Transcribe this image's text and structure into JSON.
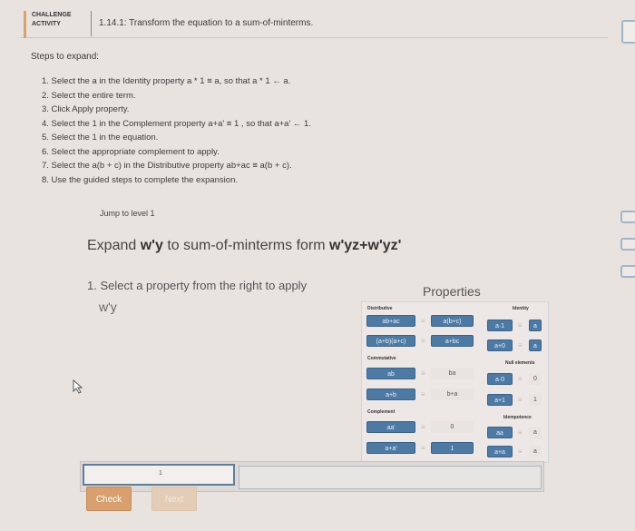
{
  "header": {
    "activity_line1": "CHALLENGE",
    "activity_line2": "ACTIVITY",
    "title": "1.14.1: Transform the equation to a sum-of-minterms."
  },
  "steps": {
    "title": "Steps to expand:",
    "items": [
      "1. Select the a in the Identity property a * 1 ≡ a, so that a * 1 ← a.",
      "2. Select the entire term.",
      "3. Click Apply property.",
      "4. Select the 1 in the Complement property a+a' ≡ 1 , so that a+a' ← 1.",
      "5. Select the 1 in the equation.",
      "6. Select the appropriate complement to apply.",
      "7. Select the a(b + c) in the Distributive property ab+ac ≡ a(b + c).",
      "8. Use the guided steps to complete the expansion."
    ]
  },
  "activity": {
    "jump_label": "Jump to level 1",
    "expand_prefix": "Expand ",
    "expand_expr": "w'y",
    "expand_middle": " to sum-of-minterms form ",
    "expand_target": "w'yz+w'yz'",
    "instruction": "1. Select a property from the right to apply",
    "current_expr": "w'y",
    "answer_value": "1",
    "check_label": "Check",
    "next_label": "Next"
  },
  "properties": {
    "title": "Properties",
    "left_column": {
      "distributive_label": "Distributive",
      "commutative_label": "Commutative",
      "complement_label": "Complement",
      "rows": [
        {
          "lhs": "ab+ac",
          "rhs": "a(b+c)"
        },
        {
          "lhs": "(a+b)(a+c)",
          "rhs": "a+bc"
        },
        {
          "lhs": "ab",
          "rhs": "ba"
        },
        {
          "lhs": "a+b",
          "rhs": "b+a"
        },
        {
          "lhs": "aa'",
          "rhs": "0"
        },
        {
          "lhs": "a+a'",
          "rhs": "1"
        }
      ]
    },
    "right_column": {
      "identity_label": "Identity",
      "null_label": "Null elements",
      "idempotence_label": "Idempotence",
      "rows": [
        {
          "lhs": "a·1",
          "rhs": "a"
        },
        {
          "lhs": "a+0",
          "rhs": "a"
        },
        {
          "lhs": "a·0",
          "rhs": "0"
        },
        {
          "lhs": "a+1",
          "rhs": "1"
        },
        {
          "lhs": "aa",
          "rhs": "a"
        },
        {
          "lhs": "a+a",
          "rhs": "a"
        }
      ]
    },
    "equiv_symbol": "≡"
  },
  "colors": {
    "tile_blue": "#4c7aa4",
    "check_orange": "#d9a06e",
    "next_disabled": "#e4cdb7",
    "accent": "#d6a46e"
  }
}
